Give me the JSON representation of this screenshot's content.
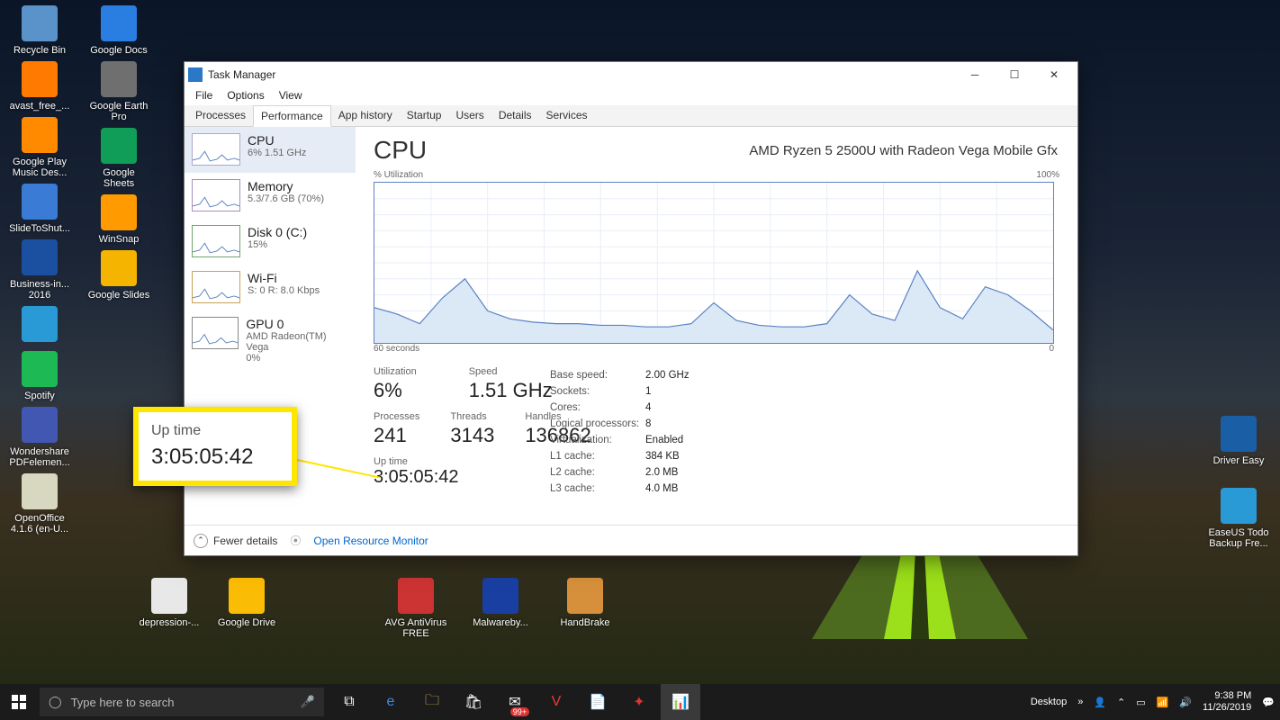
{
  "desktop_icons_col": [
    {
      "name": "recycle-bin",
      "label": "Recycle Bin",
      "color": "#5a93c9"
    },
    {
      "name": "avast",
      "label": "avast_free_...",
      "color": "#ff7a00"
    },
    {
      "name": "gplay-music",
      "label": "Google Play Music Des...",
      "color": "#ff8a00"
    },
    {
      "name": "slidetoshut",
      "label": "SlideToShut...",
      "color": "#3a7bd5"
    },
    {
      "name": "business2016",
      "label": "Business-in... 2016",
      "color": "#1b4fa0"
    },
    {
      "name": "unknown-blue",
      "label": "",
      "color": "#2a9ad6"
    },
    {
      "name": "spotify",
      "label": "Spotify",
      "color": "#1db954"
    },
    {
      "name": "pdfelement",
      "label": "Wondershare PDFelemen...",
      "color": "#4257b2"
    },
    {
      "name": "openoffice",
      "label": "OpenOffice 4.1.6 (en-U...",
      "color": "#d8d8c0"
    },
    {
      "name": "googledocs",
      "label": "Google Docs",
      "color": "#2a7de1"
    },
    {
      "name": "gearthpro",
      "label": "Google Earth Pro",
      "color": "#6f6f6f"
    },
    {
      "name": "googlesheets",
      "label": "Google Sheets",
      "color": "#0f9d58"
    },
    {
      "name": "winsnap",
      "label": "WinSnap",
      "color": "#ff9a00"
    },
    {
      "name": "googleslides",
      "label": "Google Slides",
      "color": "#f4b400"
    }
  ],
  "desktop_icons_row2": [
    {
      "name": "depression",
      "label": "depression-...",
      "color": "#e8e8e8"
    },
    {
      "name": "googledrive",
      "label": "Google Drive",
      "color": "#fbbc05"
    }
  ],
  "desktop_icons_row3": [
    {
      "name": "avg",
      "label": "AVG AntiVirus FREE",
      "color": "#c33"
    },
    {
      "name": "malwarebytes",
      "label": "Malwareby...",
      "color": "#1a3fa3"
    },
    {
      "name": "handbrake",
      "label": "HandBrake",
      "color": "#d68f3a"
    }
  ],
  "desktop_icons_right": [
    {
      "name": "drivereasy",
      "label": "Driver Easy",
      "color": "#1a5fa5"
    },
    {
      "name": "easeus",
      "label": "EaseUS Todo Backup Fre...",
      "color": "#2a9ad6"
    }
  ],
  "task_manager": {
    "title": "Task Manager",
    "menu": [
      "File",
      "Options",
      "View"
    ],
    "tabs": [
      "Processes",
      "Performance",
      "App history",
      "Startup",
      "Users",
      "Details",
      "Services"
    ],
    "active_tab": "Performance",
    "sidebar": [
      {
        "k": "cpu",
        "title": "CPU",
        "sub": "6% 1.51 GHz",
        "active": true
      },
      {
        "k": "mem",
        "title": "Memory",
        "sub": "5.3/7.6 GB (70%)"
      },
      {
        "k": "disk",
        "title": "Disk 0 (C:)",
        "sub": "15%"
      },
      {
        "k": "wifi",
        "title": "Wi-Fi",
        "sub": "S: 0 R: 8.0 Kbps"
      },
      {
        "k": "gpu",
        "title": "GPU 0",
        "sub": "AMD Radeon(TM) Vega",
        "sub2": "0%"
      }
    ],
    "main": {
      "heading": "CPU",
      "cpu_name": "AMD Ryzen 5 2500U with Radeon Vega Mobile Gfx",
      "chart_ylab": "% Utilization",
      "chart_ymax": "100%",
      "chart_xleft": "60 seconds",
      "chart_xright": "0",
      "stats_big": [
        {
          "lbl": "Utilization",
          "val": "6%"
        },
        {
          "lbl": "Speed",
          "val": "1.51 GHz"
        }
      ],
      "stats_row2": [
        {
          "lbl": "Processes",
          "val": "241"
        },
        {
          "lbl": "Threads",
          "val": "3143"
        },
        {
          "lbl": "Handles",
          "val": "136862"
        }
      ],
      "uptime_lbl": "Up time",
      "uptime_val": "3:05:05:42",
      "details": [
        {
          "k": "Base speed:",
          "v": "2.00 GHz"
        },
        {
          "k": "Sockets:",
          "v": "1"
        },
        {
          "k": "Cores:",
          "v": "4"
        },
        {
          "k": "Logical processors:",
          "v": "8"
        },
        {
          "k": "Virtualization:",
          "v": "Enabled"
        },
        {
          "k": "L1 cache:",
          "v": "384 KB"
        },
        {
          "k": "L2 cache:",
          "v": "2.0 MB"
        },
        {
          "k": "L3 cache:",
          "v": "4.0 MB"
        }
      ]
    },
    "footer": {
      "fewer": "Fewer details",
      "res_mon": "Open Resource Monitor"
    }
  },
  "callout": {
    "label": "Up time",
    "value": "3:05:05:42"
  },
  "taskbar": {
    "search_placeholder": "Type here to search",
    "desktop_label": "Desktop",
    "time": "9:38 PM",
    "date": "11/26/2019",
    "badge": "99+"
  },
  "chart_data": {
    "type": "line",
    "title": "CPU % Utilization",
    "xlabel": "seconds",
    "ylabel": "% Utilization",
    "xlim": [
      60,
      0
    ],
    "ylim": [
      0,
      100
    ],
    "x": [
      60,
      58,
      56,
      54,
      52,
      50,
      48,
      46,
      44,
      42,
      40,
      38,
      36,
      34,
      32,
      30,
      28,
      26,
      24,
      22,
      20,
      18,
      16,
      14,
      12,
      10,
      8,
      6,
      4,
      2,
      0
    ],
    "values": [
      22,
      18,
      12,
      28,
      40,
      20,
      15,
      13,
      12,
      12,
      11,
      11,
      10,
      10,
      12,
      25,
      14,
      11,
      10,
      10,
      12,
      30,
      18,
      14,
      45,
      22,
      15,
      35,
      30,
      20,
      8
    ]
  }
}
